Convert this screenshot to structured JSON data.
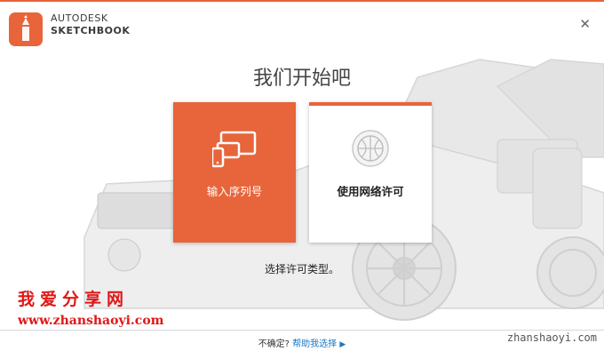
{
  "brand": {
    "line1": "AUTODESK",
    "line2": "SKETCHBOOK"
  },
  "title": "我们开始吧",
  "cards": [
    {
      "label": "输入序列号",
      "icon": "devices-icon"
    },
    {
      "label": "使用网络许可",
      "icon": "globe-icon"
    }
  ],
  "prompt": "选择许可类型。",
  "watermark": {
    "cn": "我爱分享网",
    "url": "www.zhanshaoyi.com",
    "corner": "zhanshaoyi.com"
  },
  "footer": {
    "question": "不确定?",
    "link": "帮助我选择"
  },
  "colors": {
    "accent": "#e8643a",
    "link": "#1a78c2",
    "watermark": "#e01717"
  }
}
